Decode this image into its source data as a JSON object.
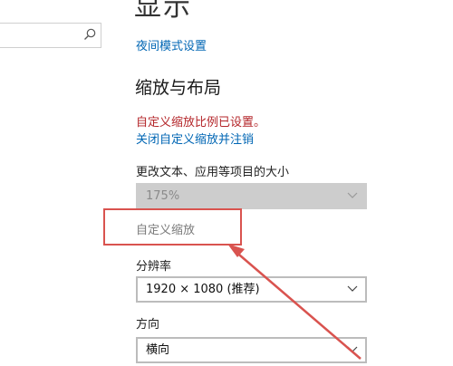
{
  "header": {
    "title": "显示"
  },
  "search": {
    "placeholder": ""
  },
  "night_light": {
    "link_label": "夜间模式设置"
  },
  "scale_layout": {
    "heading": "缩放与布局",
    "warning": "自定义缩放比例已设置。",
    "turn_off_link": "关闭自定义缩放并注销",
    "scale_label": "更改文本、应用等项目的大小",
    "scale_value": "175%",
    "custom_scale_link": "自定义缩放",
    "resolution_label": "分辨率",
    "resolution_value": "1920 × 1080 (推荐)",
    "orientation_label": "方向",
    "orientation_value": "横向"
  },
  "colors": {
    "link": "#0066b4",
    "warning": "#b4262a",
    "annotation": "#d9534f",
    "disabled_bg": "#cdcdcd"
  }
}
